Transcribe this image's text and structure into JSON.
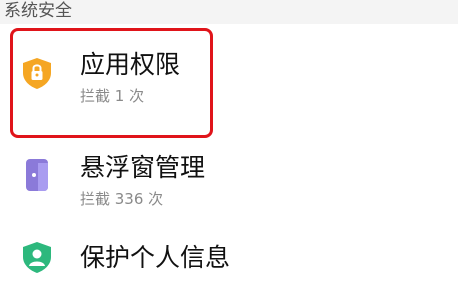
{
  "section": {
    "title": "系统安全"
  },
  "items": [
    {
      "title": "应用权限",
      "subtitle": "拦截 1 次",
      "icon": "shield-lock-icon",
      "icon_color": "#f5a623"
    },
    {
      "title": "悬浮窗管理",
      "subtitle": "拦截 336 次",
      "icon": "floating-window-icon",
      "icon_color": "#8b7ad9"
    },
    {
      "title": "保护个人信息",
      "subtitle": "",
      "icon": "shield-person-icon",
      "icon_color": "#2db87d"
    }
  ],
  "colors": {
    "highlight": "#e0141a",
    "background": "#f4f4f4"
  }
}
